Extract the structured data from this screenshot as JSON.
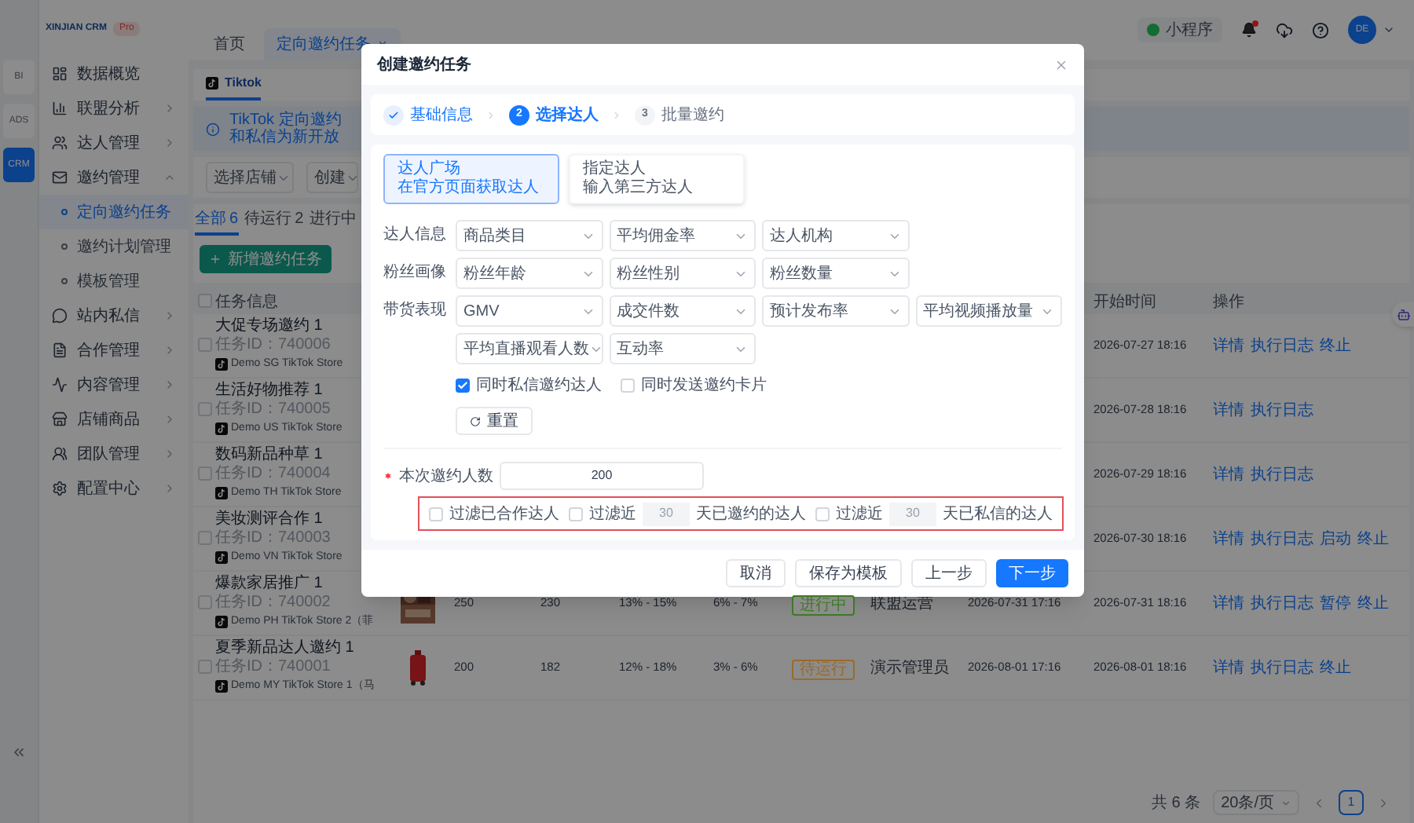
{
  "app": {
    "logo": "XINJIAN CRM",
    "edition": "Pro"
  },
  "rail": [
    {
      "label": "BI",
      "selected": false
    },
    {
      "label": "ADS",
      "selected": false
    },
    {
      "label": "CRM",
      "selected": true
    }
  ],
  "sidebar": {
    "items": [
      {
        "label": "数据概览",
        "kind": "link"
      },
      {
        "label": "联盟分析",
        "kind": "group",
        "expanded": false
      },
      {
        "label": "达人管理",
        "kind": "group",
        "expanded": false
      },
      {
        "label": "邀约管理",
        "kind": "group",
        "expanded": true,
        "children": [
          {
            "label": "定向邀约任务",
            "selected": true
          },
          {
            "label": "邀约计划管理",
            "selected": false
          },
          {
            "label": "模板管理",
            "selected": false
          }
        ]
      },
      {
        "label": "站内私信",
        "kind": "group",
        "expanded": false
      },
      {
        "label": "合作管理",
        "kind": "group",
        "expanded": false
      },
      {
        "label": "内容管理",
        "kind": "group",
        "expanded": false
      },
      {
        "label": "店铺商品",
        "kind": "group",
        "expanded": false
      },
      {
        "label": "团队管理",
        "kind": "group",
        "expanded": false
      },
      {
        "label": "配置中心",
        "kind": "group",
        "expanded": false
      }
    ]
  },
  "header": {
    "tabs": [
      {
        "label": "首页",
        "selected": false,
        "closable": false
      },
      {
        "label": "定向邀约任务",
        "selected": true,
        "closable": true
      }
    ],
    "mini_program": "小程序",
    "notification_dot": true,
    "avatar": "DE"
  },
  "platform_tabs": [
    {
      "label": "Tiktok",
      "selected": true
    }
  ],
  "banner": "TikTok 定向邀约和私信为新开放",
  "filters": [
    {
      "placeholder": "选择店铺"
    },
    {
      "placeholder": "创建"
    }
  ],
  "status_tabs": [
    {
      "label": "全部",
      "count": "6",
      "selected": true
    },
    {
      "label": "待运行",
      "count": "2",
      "selected": false
    },
    {
      "label": "进行中",
      "selected": false
    }
  ],
  "add_button": "新增邀约任务",
  "table": {
    "columns": {
      "info": "任务信息",
      "start": "开始时间",
      "actions": "操作"
    },
    "select_all": false,
    "rows": [
      {
        "checked": false,
        "name": "大促专场邀约 1",
        "task_id": "任务ID：740006",
        "store": "Demo SG TikTok Store",
        "start": "2026-07-27 18:16",
        "actions": [
          "详情",
          "执行日志",
          "终止"
        ]
      },
      {
        "checked": false,
        "name": "生活好物推荐 1",
        "task_id": "任务ID：740005",
        "store": "Demo US TikTok Store",
        "start": "2026-07-28 18:16",
        "actions": [
          "详情",
          "执行日志"
        ]
      },
      {
        "checked": false,
        "name": "数码新品种草 1",
        "task_id": "任务ID：740004",
        "store": "Demo TH TikTok Store",
        "start": "2026-07-29 18:16",
        "actions": [
          "详情",
          "执行日志"
        ]
      },
      {
        "checked": false,
        "name": "美妆测评合作 1",
        "task_id": "任务ID：740003",
        "store": "Demo VN TikTok Store",
        "start": "2026-07-30 18:16",
        "actions": [
          "详情",
          "执行日志",
          "启动",
          "终止"
        ]
      },
      {
        "checked": false,
        "name": "爆款家居推广 1",
        "task_id": "任务ID：740002",
        "store": "Demo PH TikTok Store 2（菲",
        "thumbnail": {
          "kind": "picture"
        },
        "target": "250",
        "done": "230",
        "commission": "13% - 15%",
        "rate": "6% - 7%",
        "status": {
          "label": "进行中",
          "color": "#3f7a24"
        },
        "owner": "联盟运营",
        "created": "2026-07-31 17:16",
        "start": "2026-07-31 18:16",
        "actions": [
          "详情",
          "执行日志",
          "暂停",
          "终止"
        ]
      },
      {
        "checked": false,
        "name": "夏季新品达人邀约 1",
        "task_id": "任务ID：740001",
        "store": "Demo MY TikTok Store 1（马",
        "thumbnail": {
          "kind": "picture"
        },
        "target": "200",
        "done": "182",
        "commission": "12% - 18%",
        "rate": "3% - 6%",
        "status": {
          "label": "待运行",
          "color": "#9a6a2c"
        },
        "owner": "演示管理员",
        "created": "2026-08-01 17:16",
        "start": "2026-08-01 18:16",
        "actions": [
          "详情",
          "执行日志",
          "终止"
        ]
      }
    ]
  },
  "pagination": {
    "total": "共 6 条",
    "page_size": "20条/页",
    "pages": [
      {
        "label": "1",
        "selected": true
      }
    ]
  },
  "modal": {
    "title": "创建邀约任务",
    "steps": [
      {
        "label": "基础信息",
        "done": true,
        "selected": false
      },
      {
        "number": "2",
        "label": "选择达人",
        "done": false,
        "selected": true
      },
      {
        "number": "3",
        "label": "批量邀约",
        "done": false,
        "selected": false
      }
    ],
    "sources": [
      {
        "title": "达人广场",
        "subtitle": "在官方页面获取达人",
        "selected": true
      },
      {
        "title": "指定达人",
        "subtitle": "输入第三方达人",
        "selected": false
      }
    ],
    "filter_groups": [
      {
        "label": "达人信息",
        "options": [
          "商品类目",
          "平均佣金率",
          "达人机构"
        ]
      },
      {
        "label": "粉丝画像",
        "options": [
          "粉丝年龄",
          "粉丝性别",
          "粉丝数量"
        ]
      },
      {
        "label": "带货表现",
        "options": [
          "GMV",
          "成交件数",
          "预计发布率",
          "平均视频播放量",
          "平均直播观看人数",
          "互动率"
        ]
      }
    ],
    "options": [
      {
        "label": "同时私信邀约达人",
        "checked": true
      },
      {
        "label": "同时发送邀约卡片",
        "checked": false
      }
    ],
    "reset": "重置",
    "count": {
      "label": "本次邀约人数",
      "required": true,
      "value": "200"
    },
    "exclusions": {
      "highlighted": true,
      "items": [
        {
          "kind": "plain",
          "label": "过滤已合作达人",
          "checked": false
        },
        {
          "kind": "days",
          "prefix": "过滤近",
          "value": "30",
          "disabled": true,
          "suffix": "天已邀约的达人",
          "checked": false
        },
        {
          "kind": "days",
          "prefix": "过滤近",
          "value": "30",
          "disabled": true,
          "suffix": "天已私信的达人",
          "checked": false
        }
      ]
    },
    "buttons": [
      {
        "label": "取消",
        "kind": "default"
      },
      {
        "label": "保存为模板",
        "kind": "default"
      },
      {
        "label": "上一步",
        "kind": "default"
      },
      {
        "label": "下一步",
        "kind": "primary"
      }
    ]
  }
}
